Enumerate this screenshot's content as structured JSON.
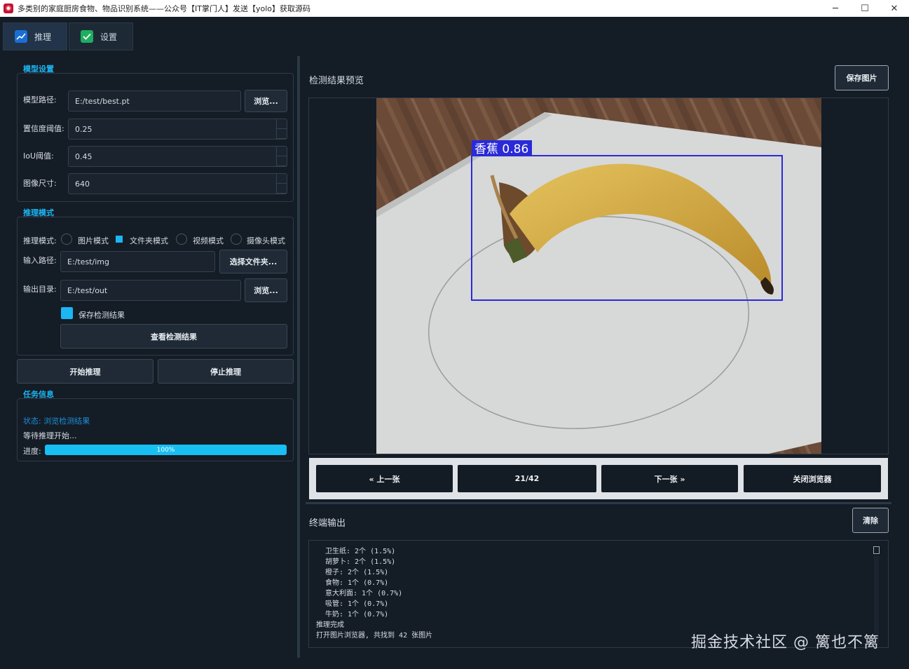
{
  "window": {
    "title": "多类别的家庭厨房食物、物品识别系统——公众号【IT掌门人】发送【yolo】获取源码",
    "minimize": "─",
    "maximize": "☐",
    "close": "✕"
  },
  "tabs": [
    {
      "label": "推理",
      "icon": "chart-line-icon"
    },
    {
      "label": "设置",
      "icon": "check-badge-icon"
    }
  ],
  "model_settings": {
    "title": "模型设置",
    "model_path_label": "模型路径:",
    "model_path_value": "E:/test/best.pt",
    "browse_label": "浏览...",
    "confidence_label": "置信度阈值:",
    "confidence_value": "0.25",
    "iou_label": "IoU阈值:",
    "iou_value": "0.45",
    "imgsize_label": "图像尺寸:",
    "imgsize_value": "640"
  },
  "inference_mode": {
    "title": "推理模式",
    "mode_label": "推理模式:",
    "modes": [
      "图片模式",
      "文件夹模式",
      "视频模式",
      "摄像头模式"
    ],
    "selected_mode": "文件夹模式",
    "input_label": "输入路径:",
    "input_value": "E:/test/img",
    "select_folder_label": "选择文件夹...",
    "output_label": "输出目录:",
    "output_value": "E:/test/out",
    "browse_label": "浏览...",
    "save_results_label": "保存检测结果",
    "save_results_checked": true,
    "view_results_label": "查看检测结果"
  },
  "actions": {
    "start_label": "开始推理",
    "stop_label": "停止推理"
  },
  "task_info": {
    "title": "任务信息",
    "status_text": "状态: 浏览检测结果",
    "waiting_text": "等待推理开始...",
    "progress_label": "进度:",
    "progress_value": 1.0,
    "progress_text": "100%"
  },
  "preview": {
    "title": "检测结果预览",
    "save_image_label": "保存图片",
    "detection_label": "香蕉 0.86",
    "box_color": "#2a2ad8"
  },
  "navigation": {
    "prev_label": "« 上一张",
    "counter_text": "21/42",
    "next_label": "下一张 »",
    "close_label": "关闭浏览器"
  },
  "terminal": {
    "title": "终端输出",
    "clear_label": "清除",
    "lines": [
      {
        "text": "卫生纸: 2个 (1.5%)",
        "indent": true
      },
      {
        "text": "胡萝卜: 2个 (1.5%)",
        "indent": true
      },
      {
        "text": "橙子: 2个 (1.5%)",
        "indent": true
      },
      {
        "text": "食物: 1个 (0.7%)",
        "indent": true
      },
      {
        "text": "意大利面: 1个 (0.7%)",
        "indent": true
      },
      {
        "text": "吸管: 1个 (0.7%)",
        "indent": true
      },
      {
        "text": "牛奶: 1个 (0.7%)",
        "indent": true
      },
      {
        "text": "推理完成",
        "indent": false
      },
      {
        "text": "打开图片浏览器, 共找到 42 张图片",
        "indent": false
      }
    ]
  },
  "watermark": "掘金技术社区 @ 篱也不篱",
  "colors": {
    "accent": "#1bb6f3",
    "background": "#141c26"
  }
}
